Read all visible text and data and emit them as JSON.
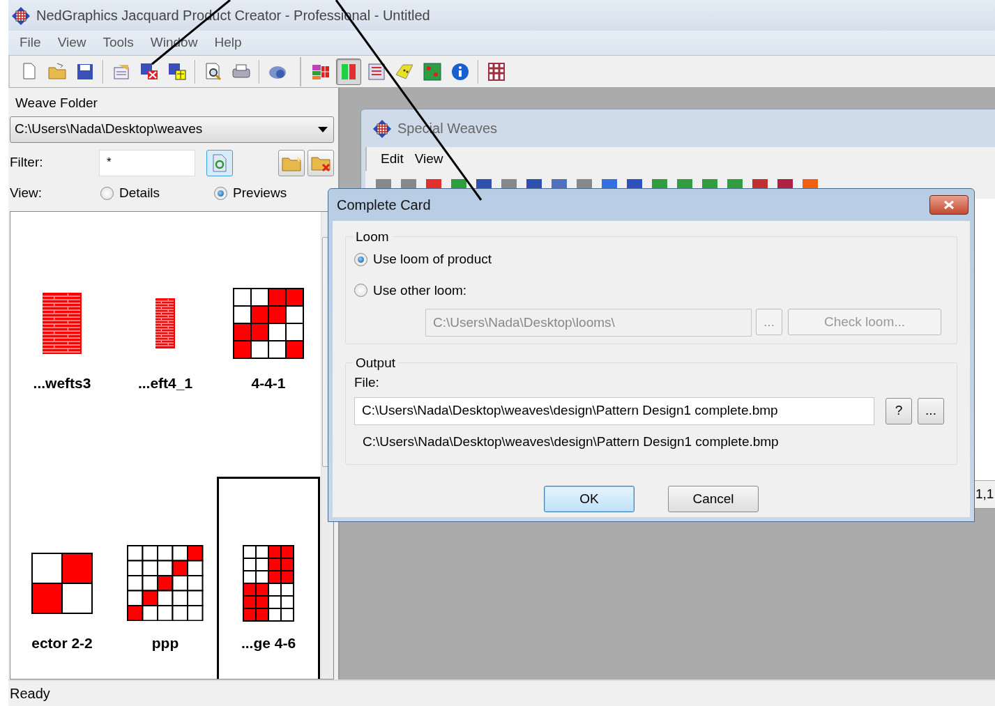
{
  "window": {
    "title": "NedGraphics Jacquard Product Creator - Professional - Untitled"
  },
  "menu": [
    "File",
    "View",
    "Tools",
    "Window",
    "Help"
  ],
  "toolbar": [
    {
      "kind": "button",
      "pressed": false
    },
    {
      "kind": "button",
      "pressed": false
    },
    {
      "kind": "button",
      "pressed": false
    },
    {
      "kind": "separator"
    },
    {
      "kind": "button",
      "pressed": false
    },
    {
      "kind": "button",
      "pressed": false
    },
    {
      "kind": "button",
      "pressed": false
    },
    {
      "kind": "separator"
    },
    {
      "kind": "button",
      "pressed": false
    },
    {
      "kind": "button",
      "pressed": false
    },
    {
      "kind": "separator"
    },
    {
      "kind": "button",
      "pressed": false
    },
    {
      "kind": "gap"
    },
    {
      "kind": "button",
      "pressed": false
    },
    {
      "kind": "button",
      "pressed": true
    },
    {
      "kind": "button",
      "pressed": false
    },
    {
      "kind": "button",
      "pressed": false
    },
    {
      "kind": "button",
      "pressed": false
    },
    {
      "kind": "button",
      "pressed": false
    },
    {
      "kind": "separator"
    },
    {
      "kind": "button",
      "pressed": false
    }
  ],
  "weave_panel": {
    "title": "Weave Folder",
    "folder": "C:\\Users\\Nada\\Desktop\\weaves",
    "filter_label": "Filter:",
    "filter": "*",
    "view_label": "View:",
    "view_options": [
      {
        "label": "Details",
        "selected": false
      },
      {
        "label": "Previews",
        "selected": true
      }
    ],
    "weaves": [
      {
        "name": "...wefts3",
        "selected": false
      },
      {
        "name": "...eft4_1",
        "selected": false
      },
      {
        "name": "4-4-1",
        "selected": false
      },
      {
        "name": "ector 2-2",
        "selected": false
      },
      {
        "name": "ppp",
        "selected": false
      },
      {
        "name": "...ge 4-6",
        "selected": true
      }
    ]
  },
  "special_window": {
    "title": "Special Weaves",
    "menu": [
      "Edit",
      "View"
    ],
    "status": "1,1"
  },
  "dialog": {
    "title": "Complete Card",
    "loom_group": "Loom",
    "loom_options": [
      {
        "label": "Use loom of product",
        "selected": true
      },
      {
        "label": "Use other loom:",
        "selected": false
      }
    ],
    "loom_field": {
      "value": "C:\\Users\\Nada\\Desktop\\looms\\",
      "disabled": true
    },
    "loom_buttons": [
      {
        "label": "...",
        "disabled": true
      },
      {
        "label": "Check loom...",
        "disabled": true
      }
    ],
    "output_group": "Output",
    "file_label": "File:",
    "file": "C:\\Users\\Nada\\Desktop\\weaves\\design\\Pattern Design1 complete.bmp",
    "file_buttons": [
      {
        "label": "?",
        "disabled": false
      },
      {
        "label": "...",
        "disabled": false
      }
    ],
    "resolved_path": "C:\\Users\\Nada\\Desktop\\weaves\\design\\Pattern Design1 complete.bmp",
    "buttons": [
      {
        "label": "OK",
        "default": true
      },
      {
        "label": "Cancel",
        "default": false
      }
    ]
  },
  "status_bar": {
    "text": "Ready"
  }
}
